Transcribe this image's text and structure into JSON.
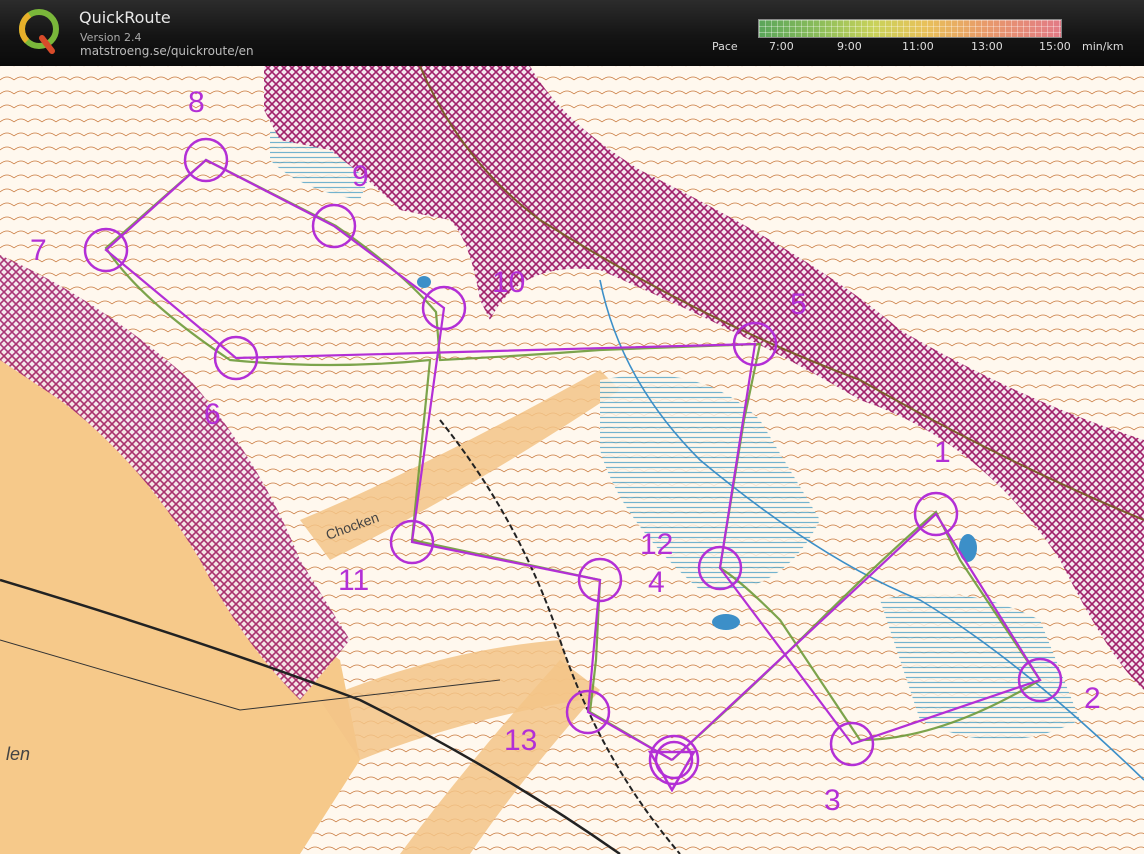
{
  "app": {
    "title": "QuickRoute",
    "version": "Version 2.4",
    "url": "matstroeng.se/quickroute/en"
  },
  "pace_scale": {
    "label": "Pace",
    "ticks": [
      "7:00",
      "9:00",
      "11:00",
      "13:00",
      "15:00"
    ],
    "unit": "min/km",
    "colors": [
      "#5aa55a",
      "#c9d25a",
      "#e8c15a",
      "#e27a86"
    ]
  },
  "map": {
    "place_names": [
      "Chocken",
      "len"
    ],
    "control_labels": [
      "1",
      "2",
      "3",
      "4",
      "5",
      "6",
      "7",
      "8",
      "9",
      "10",
      "11",
      "12",
      "13"
    ],
    "course_color": "#b32fd6",
    "forbidden_color": "#a0206a"
  }
}
